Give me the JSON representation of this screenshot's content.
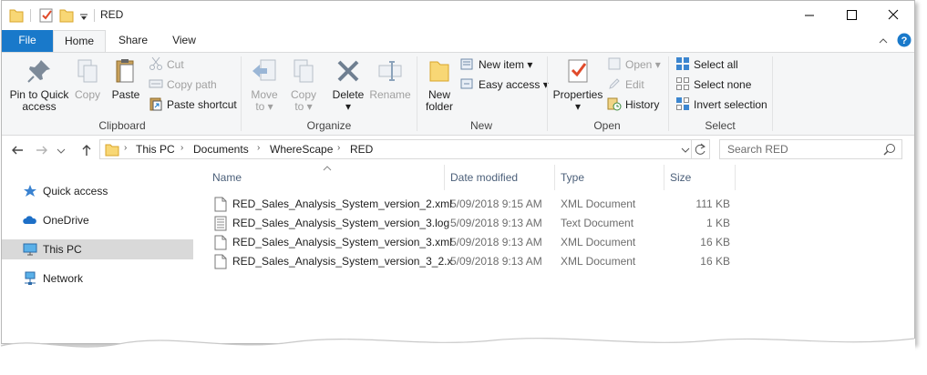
{
  "window": {
    "title": "RED"
  },
  "ribbon_tabs": [
    {
      "label": "File"
    },
    {
      "label": "Home"
    },
    {
      "label": "Share"
    },
    {
      "label": "View"
    }
  ],
  "ribbon": {
    "clipboard": {
      "pin_label_1": "Pin to Quick",
      "pin_label_2": "access",
      "copy": "Copy",
      "paste": "Paste",
      "cut": "Cut",
      "copy_path": "Copy path",
      "paste_shortcut": "Paste shortcut",
      "group": "Clipboard"
    },
    "organize": {
      "move_1": "Move",
      "move_2": "to",
      "copy_1": "Copy",
      "copy_2": "to",
      "delete": "Delete",
      "rename": "Rename",
      "group": "Organize"
    },
    "new": {
      "new_folder_1": "New",
      "new_folder_2": "folder",
      "new_item": "New item",
      "easy_access": "Easy access",
      "group": "New"
    },
    "open": {
      "properties": "Properties",
      "open": "Open",
      "edit": "Edit",
      "history": "History",
      "group": "Open"
    },
    "select": {
      "select_all": "Select all",
      "select_none": "Select none",
      "invert": "Invert selection",
      "group": "Select"
    }
  },
  "breadcrumb": [
    "This PC",
    "Documents",
    "WhereScape",
    "RED"
  ],
  "search": {
    "placeholder": "Search RED"
  },
  "nav_pane": [
    {
      "label": "Quick access",
      "icon": "star-icon"
    },
    {
      "label": "OneDrive",
      "icon": "cloud-icon"
    },
    {
      "label": "This PC",
      "icon": "monitor-icon",
      "selected": true
    },
    {
      "label": "Network",
      "icon": "network-icon"
    }
  ],
  "columns": [
    "Name",
    "Date modified",
    "Type",
    "Size"
  ],
  "files": [
    {
      "name": "RED_Sales_Analysis_System_version_2.xml",
      "date": "5/09/2018 9:15 AM",
      "type": "XML Document",
      "size": "111 KB",
      "icon": "xml-file-icon"
    },
    {
      "name": "RED_Sales_Analysis_System_version_3.log",
      "date": "5/09/2018 9:13 AM",
      "type": "Text Document",
      "size": "1 KB",
      "icon": "text-file-icon"
    },
    {
      "name": "RED_Sales_Analysis_System_version_3.xml",
      "date": "5/09/2018 9:13 AM",
      "type": "XML Document",
      "size": "16 KB",
      "icon": "xml-file-icon"
    },
    {
      "name": "RED_Sales_Analysis_System_version_3_2.x",
      "date": "5/09/2018 9:13 AM",
      "type": "XML Document",
      "size": "16 KB",
      "icon": "xml-file-icon"
    }
  ],
  "colors": {
    "accent": "#1979ca",
    "selected_row": "#d9d9d9",
    "help": "#1979ca"
  }
}
